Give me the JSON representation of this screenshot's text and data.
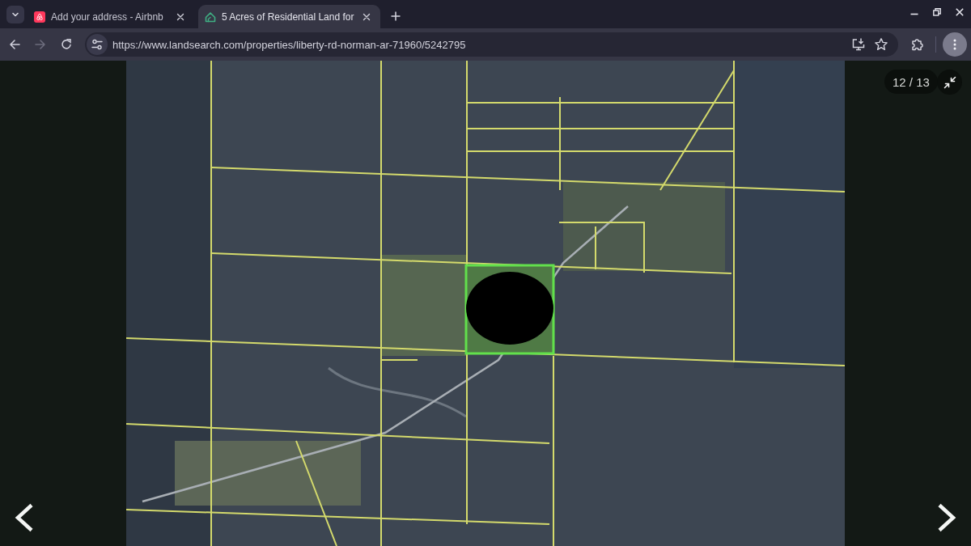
{
  "tab_strip": {
    "tabs": [
      {
        "title": "Add your address - Airbnb",
        "selected": false
      },
      {
        "title": "5 Acres of Residential Land for",
        "selected": true
      }
    ]
  },
  "toolbar": {
    "nav_buttons": [
      {
        "kind": "back",
        "disabled": false
      },
      {
        "kind": "forward",
        "disabled": true
      },
      {
        "kind": "reload",
        "disabled": false
      }
    ],
    "address_bar": {
      "url": "https://www.landsearch.com/properties/liberty-rd-norman-ar-71960/5242795"
    }
  },
  "gallery": {
    "counter": "12 / 13"
  }
}
